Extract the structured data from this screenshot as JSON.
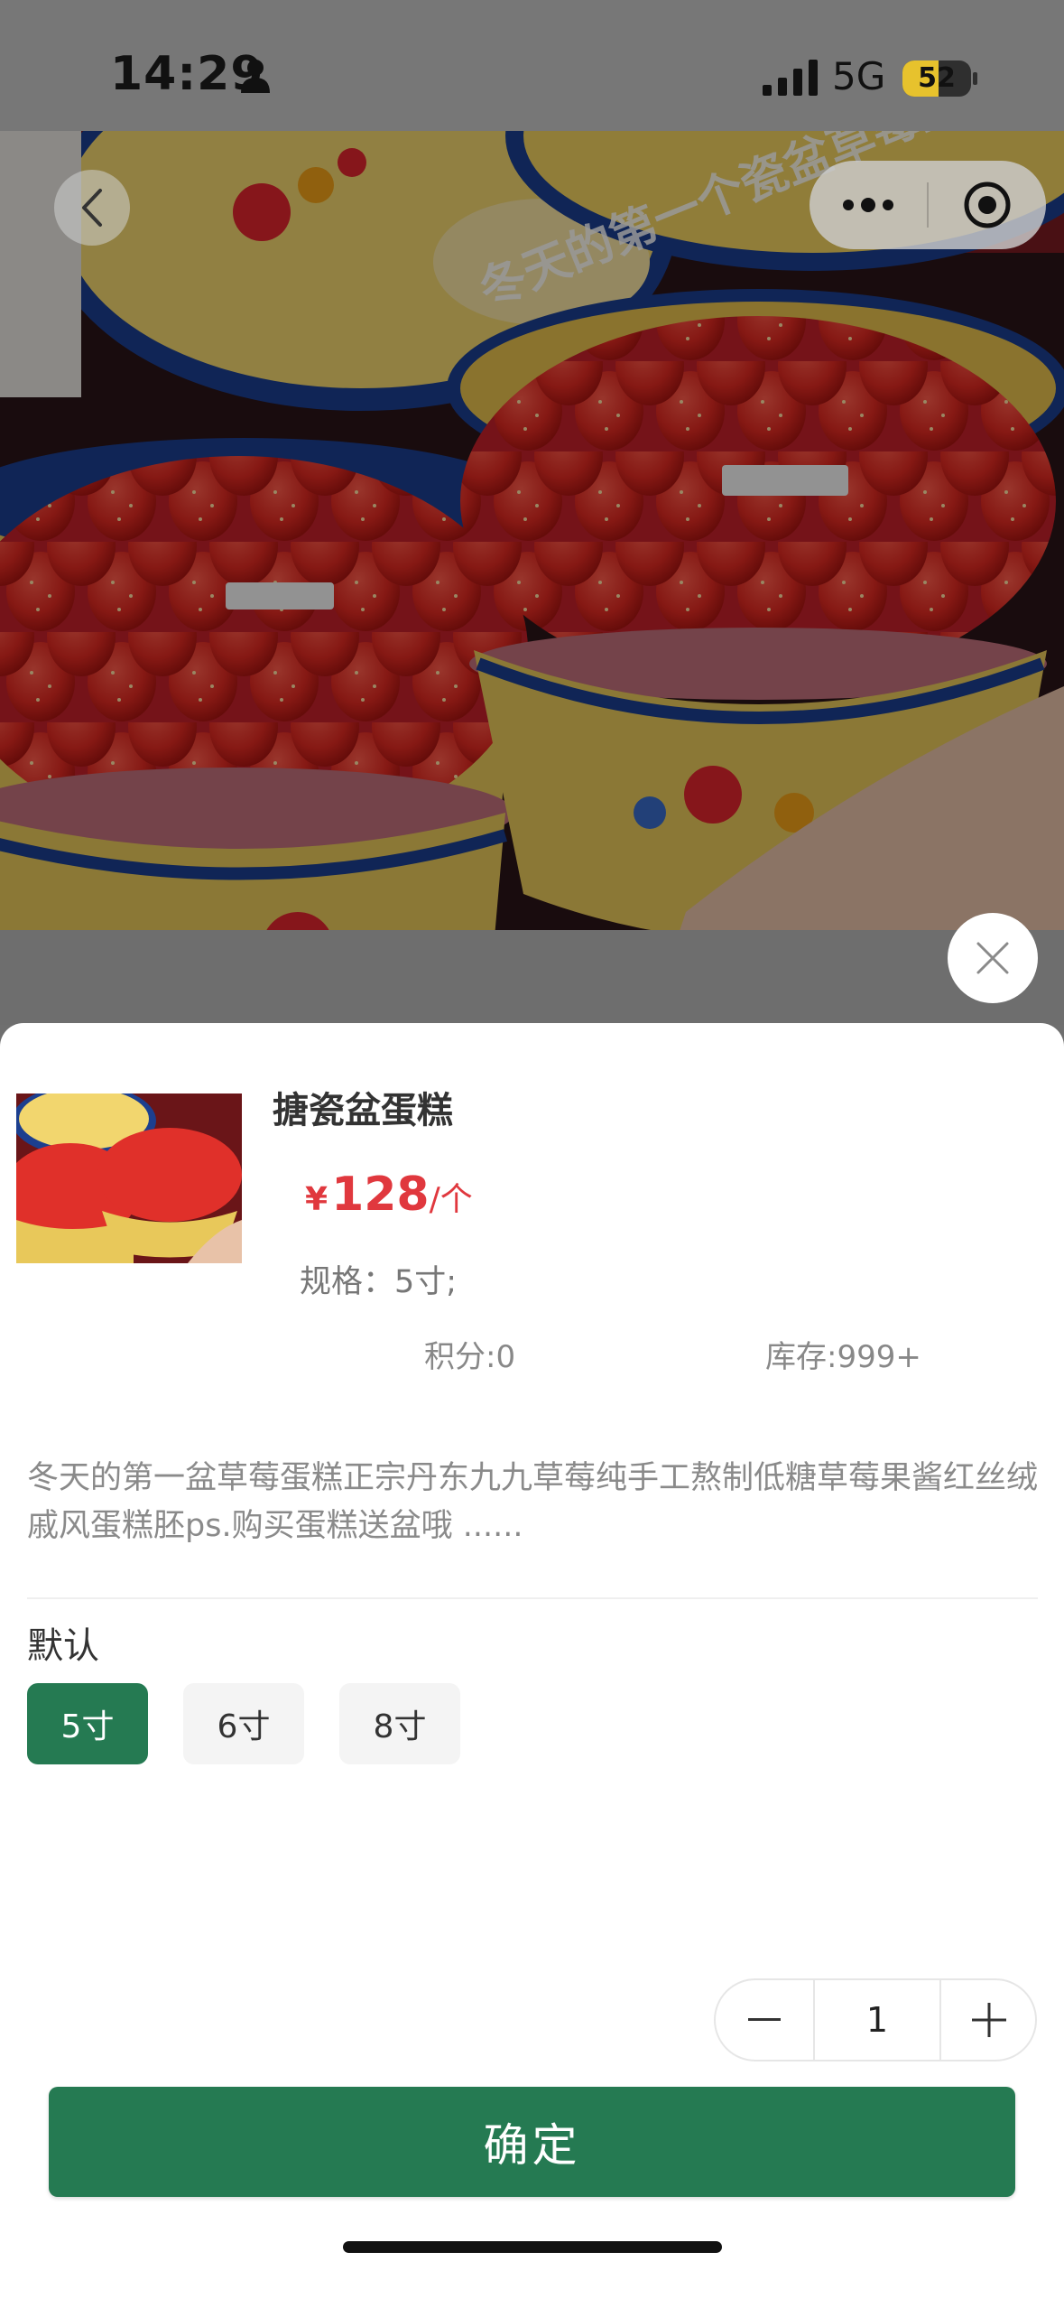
{
  "status_bar": {
    "time": "14:29",
    "network": "5G",
    "battery": "52",
    "battery_level": 0.52
  },
  "photo": {
    "caption": "冬天的第一个瓷盆草莓蛋糕~"
  },
  "icons": {
    "back": "chevron-left-icon",
    "more": "more-dots-icon",
    "target": "target-icon",
    "close": "close-icon",
    "minus": "minus-icon",
    "plus": "plus-icon"
  },
  "product": {
    "title": "搪瓷盆蛋糕",
    "currency": "¥",
    "price": "128",
    "unit": "/个",
    "spec": "规格：5寸;",
    "points": "积分:0",
    "stock": "库存:999+",
    "description": "冬天的第一盆草莓蛋糕正宗丹东九九草莓纯手工熬制低糖草莓果酱红丝绒戚风蛋糕胚ps.购买蛋糕送盆哦 ......"
  },
  "options": {
    "group_label": "默认",
    "items": [
      {
        "label": "5寸",
        "selected": true
      },
      {
        "label": "6寸",
        "selected": false
      },
      {
        "label": "8寸",
        "selected": false
      }
    ]
  },
  "quantity": {
    "value": "1"
  },
  "confirm_label": "确定",
  "colors": {
    "accent_green": "#257a52",
    "price_red": "#e0383e"
  }
}
